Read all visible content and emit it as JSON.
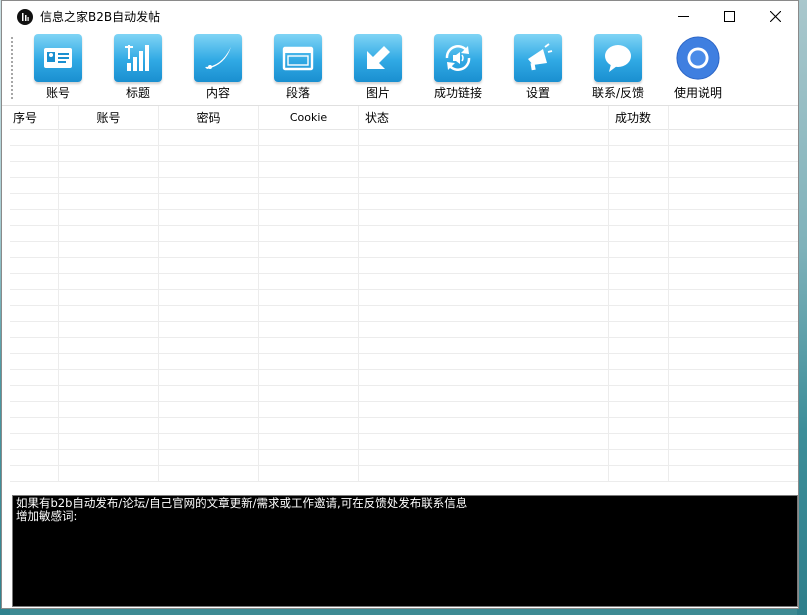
{
  "window": {
    "title": "信息之家B2B自动发帖"
  },
  "toolbar": {
    "items": [
      {
        "label": "账号",
        "icon": "id-card-icon"
      },
      {
        "label": "标题",
        "icon": "signal-bars-icon"
      },
      {
        "label": "内容",
        "icon": "swoosh-icon"
      },
      {
        "label": "段落",
        "icon": "window-icon"
      },
      {
        "label": "图片",
        "icon": "arrow-down-left-icon"
      },
      {
        "label": "成功链接",
        "icon": "sync-sound-icon"
      },
      {
        "label": "设置",
        "icon": "megaphone-icon"
      },
      {
        "label": "联系/反馈",
        "icon": "chat-bubble-icon"
      },
      {
        "label": "使用说明",
        "icon": "browser-icon"
      }
    ]
  },
  "grid": {
    "columns": [
      "序号",
      "账号",
      "密码",
      "Cookie",
      "状态",
      "成功数"
    ],
    "rows": 22
  },
  "log": {
    "lines": [
      "如果有b2b自动发布/论坛/自己官网的文章更新/需求或工作邀请,可在反馈处发布联系信息",
      "增加敏感词:"
    ]
  },
  "colors": {
    "toolbar_icon_top": "#7fd4f5",
    "toolbar_icon_bottom": "#1a8fd0",
    "log_bg": "#000000"
  }
}
